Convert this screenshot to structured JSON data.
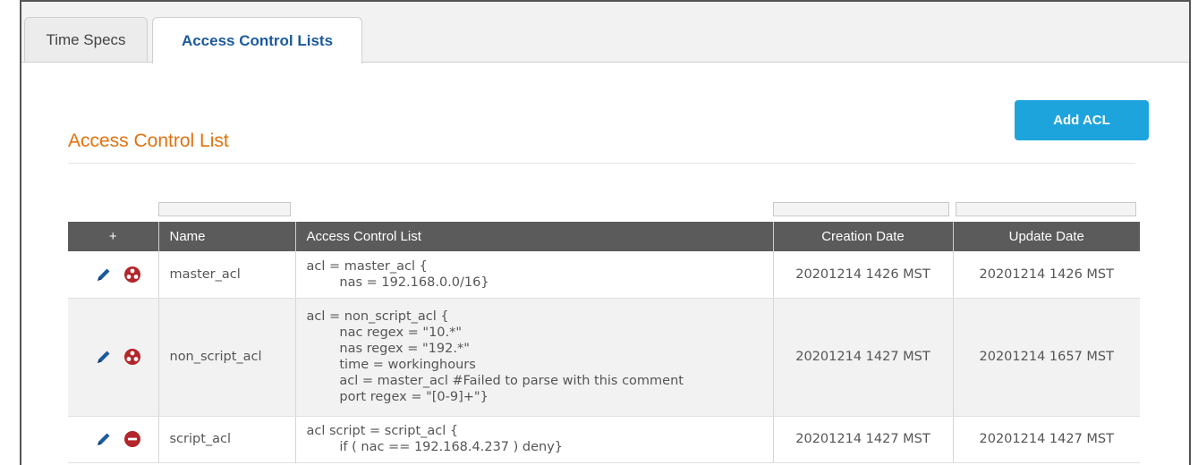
{
  "tabs": [
    {
      "label": "Time Specs"
    },
    {
      "label": "Access Control Lists"
    }
  ],
  "section": {
    "title": "Access Control List",
    "add_button": "Add ACL"
  },
  "table": {
    "columns": {
      "actions": "+",
      "name": "Name",
      "acl": "Access Control List",
      "created": "Creation Date",
      "updated": "Update Date"
    },
    "rows": [
      {
        "name": "master_acl",
        "acl": "acl = master_acl {\n        nas = 192.168.0.0/16}",
        "created": "20201214 1426 MST",
        "updated": "20201214 1426 MST",
        "status_icon": "error-icon"
      },
      {
        "name": "non_script_acl",
        "acl": "acl = non_script_acl {\n        nac regex = \"10.*\"\n        nas regex = \"192.*\"\n        time = workinghours\n        acl = master_acl #Failed to parse with this comment\n        port regex = \"[0-9]+\"}",
        "created": "20201214 1427 MST",
        "updated": "20201214 1657 MST",
        "status_icon": "error-icon"
      },
      {
        "name": "script_acl",
        "acl": "acl script = script_acl {\n        if ( nac == 192.168.4.237 ) deny}",
        "created": "20201214 1427 MST",
        "updated": "20201214 1427 MST",
        "status_icon": "delete-icon"
      }
    ]
  },
  "colors": {
    "accent_title": "#e2720e",
    "button": "#1ea4dd",
    "header_bg": "#5b5b5b",
    "edit_icon": "#1c5a9e",
    "status_icon": "#b3262b"
  }
}
